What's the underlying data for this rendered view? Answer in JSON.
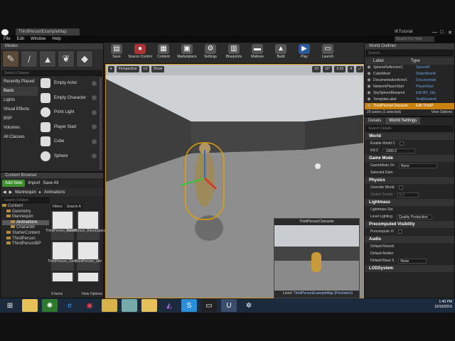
{
  "app": {
    "title": "ThirdPersonExampleMap",
    "ik_label": "IKTutorial",
    "search_help": "Search For Help"
  },
  "menu": [
    "File",
    "Edit",
    "Window",
    "Help"
  ],
  "modes": {
    "title": "Modes",
    "search_placeholder": "Search Classes",
    "categories": [
      "Recently Placed",
      "Basic",
      "Lights",
      "Visual Effects",
      "BSP",
      "Volumes",
      "All Classes"
    ],
    "items": [
      "Empty Actor",
      "Empty Character",
      "Point Light",
      "Player Start",
      "Cube",
      "Sphere"
    ]
  },
  "content_browser": {
    "title": "Content Browser",
    "add_new": "Add New",
    "import": "Import",
    "save_all": "Save All",
    "breadcrumb": [
      "Mannequin",
      "Animations"
    ],
    "search_folders": "Search Folders",
    "filters": "Filters",
    "search_assets": "Search A",
    "tree": [
      "Content",
      "Geometry",
      "Mannequin",
      "Animations",
      "Character",
      "StarterContent",
      "ThirdPerson",
      "ThirdPersonBP"
    ],
    "assets": [
      "ThirdPerson_AnimBP",
      "ThirdPerson_BlendSpace1D",
      "ThirdPerson_Jump",
      "ThirdPerson_Idle",
      "",
      ""
    ],
    "count": "9 items",
    "view_options": "View Options"
  },
  "toolbar": [
    "Save",
    "Source Control",
    "Content",
    "Marketplace",
    "Settings",
    "Blueprints",
    "Matinee",
    "Build",
    "Play",
    "Launch"
  ],
  "viewport": {
    "buttons": [
      "Perspective",
      "Lit",
      "Show"
    ],
    "snap_values": [
      "10",
      "10°",
      "0.25",
      "4"
    ],
    "pip_title": "ThirdPersonCharacter",
    "level_label": "Level:",
    "level_name": "ThirdPersonExampleMap (Persistent)"
  },
  "outliner": {
    "title": "World Outliner",
    "search_placeholder": "Search...",
    "col_label": "Label",
    "col_type": "Type",
    "rows": [
      {
        "label": "SphereReflectionC",
        "type": "SphereR"
      },
      {
        "label": "CubeMesh",
        "type": "StaticMeshA"
      },
      {
        "label": "DocumentationActor1",
        "type": "Documentati"
      },
      {
        "label": "NetworkPlayerStart",
        "type": "PlayerStart"
      },
      {
        "label": "SkySphereBlueprint",
        "type": "Edit BP_Sky"
      },
      {
        "label": "TemplateLabel",
        "type": "TextRenderA"
      },
      {
        "label": "ThirdPersonCharacter",
        "type": "Edit ThirdP"
      }
    ],
    "count": "20 actors (1 selected)",
    "view_options": "View Options"
  },
  "details": {
    "tabs": [
      "Details",
      "World Settings"
    ],
    "search_placeholder": "Search Details",
    "sections": [
      {
        "name": "World",
        "props": [
          {
            "label": "Enable World C",
            "value": ""
          },
          {
            "label": "Kill Z",
            "value": "-1000.0"
          }
        ]
      },
      {
        "name": "Game Mode",
        "props": [
          {
            "label": "GameMode Ov",
            "value": "None"
          },
          {
            "label": "Selected Gam",
            "value": ""
          }
        ]
      },
      {
        "name": "Physics",
        "props": [
          {
            "label": "Override World",
            "value": ""
          },
          {
            "label": "Global Gravity",
            "value": "0.0"
          }
        ]
      },
      {
        "name": "Lightmass",
        "props": [
          {
            "label": "Lightmass Set",
            "value": ""
          },
          {
            "label": "Level Lighting",
            "value": "Quality Production"
          }
        ]
      },
      {
        "name": "Precomputed Visibility",
        "props": [
          {
            "label": "Precompute Vi",
            "value": ""
          }
        ]
      },
      {
        "name": "Audio",
        "props": [
          {
            "label": "Default Reverb",
            "value": ""
          },
          {
            "label": "Default Ambier",
            "value": ""
          },
          {
            "label": "Default Base S",
            "value": "None"
          }
        ]
      },
      {
        "name": "LODSystem",
        "props": []
      }
    ]
  },
  "taskbar": {
    "time": "1:40 PM",
    "date": "10/16/2015"
  }
}
